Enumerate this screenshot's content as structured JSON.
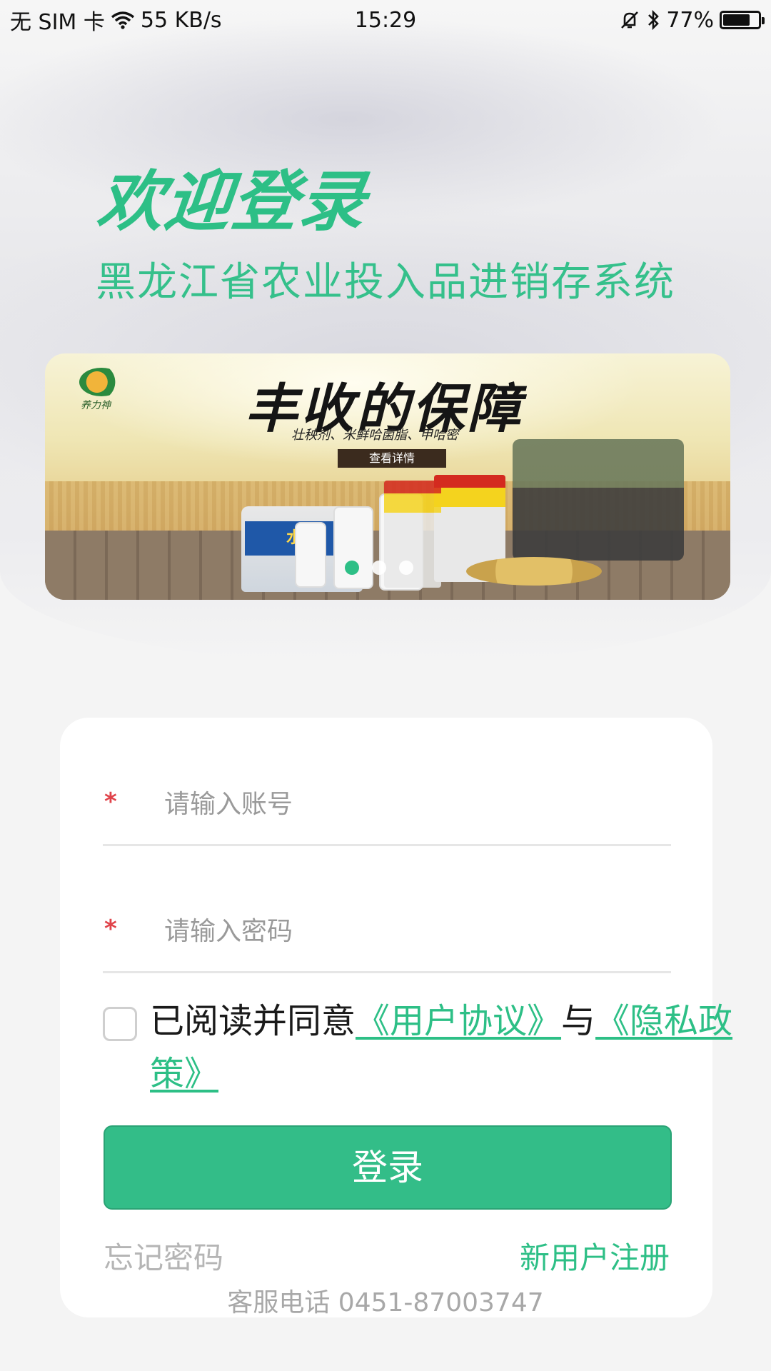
{
  "status_bar": {
    "carrier": "无 SIM 卡",
    "net_speed": "55 KB/s",
    "time": "15:29",
    "battery": "77%",
    "battery_level": 0.77
  },
  "header": {
    "welcome": "欢迎登录",
    "system_name": "黑龙江省农业投入品进销存系统"
  },
  "banner": {
    "brand": "养力神",
    "headline": "丰收的保障",
    "tagline": "壮秧剂、米鲜哈菌脂、甲哈密",
    "cta": "查看详情",
    "product_label": "水稻",
    "dot_count": 3,
    "active_dot": 0
  },
  "form": {
    "account_placeholder": "请输入账号",
    "password_placeholder": "请输入密码",
    "required_mark": "*",
    "agree_prefix": "已阅读并同意",
    "user_agreement": "《用户协议》",
    "agree_join": "与",
    "privacy_policy": "《隐私政策》",
    "login_label": "登录",
    "forgot_password": "忘记密码",
    "register": "新用户注册",
    "service_phone": "客服电话 0451-87003747"
  },
  "colors": {
    "accent": "#2dbf86",
    "button": "#33bd88",
    "required": "#e0434a"
  }
}
